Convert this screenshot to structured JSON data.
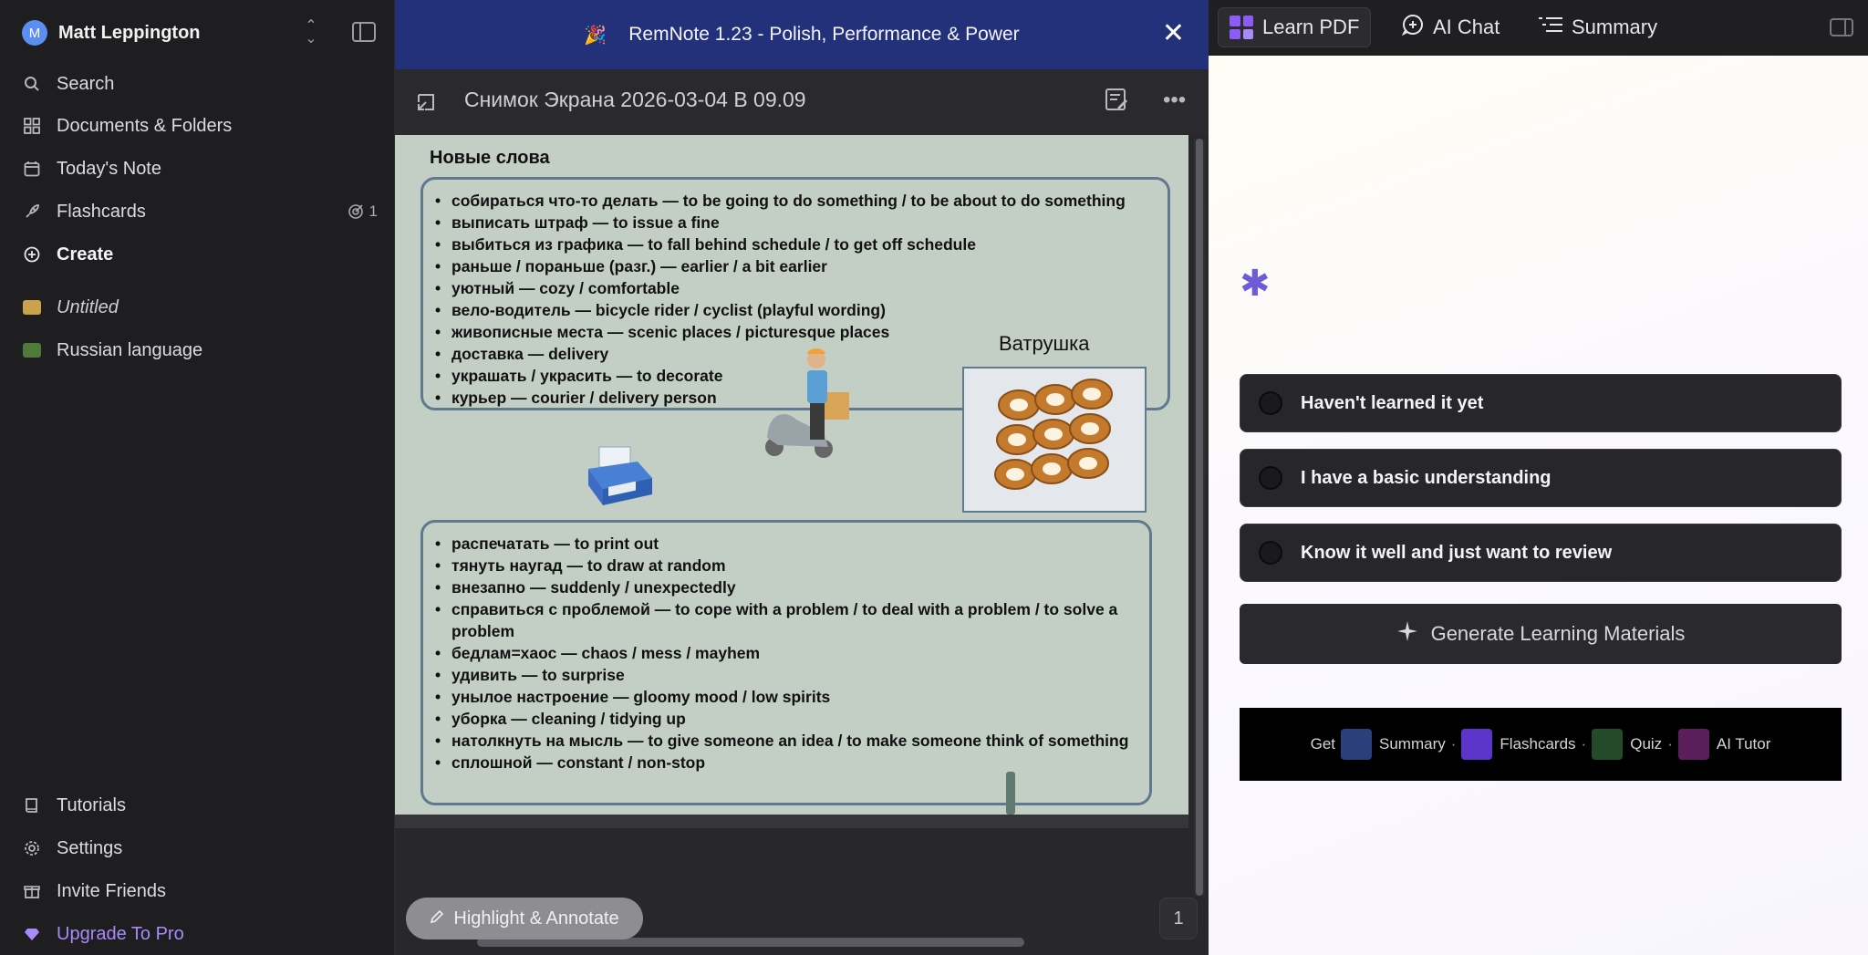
{
  "sidebar": {
    "user": {
      "initial": "M",
      "name": "Matt Leppington"
    },
    "nav": {
      "search": "Search",
      "documents": "Documents & Folders",
      "today": "Today's Note",
      "flashcards": "Flashcards",
      "flashcards_badge": "1",
      "create": "Create"
    },
    "folders": [
      {
        "label": "Untitled",
        "color": "#c9a24b"
      },
      {
        "label": "Russian language",
        "color": "#4f7a3a"
      }
    ],
    "bottom": {
      "tutorials": "Tutorials",
      "settings": "Settings",
      "invite": "Invite Friends",
      "upgrade": "Upgrade To Pro"
    }
  },
  "banner": {
    "text": "RemNote 1.23 - Polish, Performance & Power"
  },
  "document": {
    "title": "Снимок Экрана 2026-03-04 В 09.09",
    "page_heading": "Новые слова",
    "list1": [
      "собираться что-то делать — to be going to do something / to be about to do something",
      "выписать штраф — to issue a fine",
      "выбиться из графика — to fall behind schedule / to get off schedule",
      "раньше / пораньше (разг.) — earlier / a bit earlier",
      "уютный — cozy / comfortable",
      "вело-водитель — bicycle rider / cyclist (playful wording)",
      "живописные места — scenic places / picturesque places",
      "доставка — delivery",
      "украшать / украсить — to decorate",
      "курьер — courier / delivery person"
    ],
    "image_caption": "Ватрушка",
    "list2": [
      "распечатать — to print out",
      "тянуть наугад — to draw at random",
      "внезапно — suddenly / unexpectedly",
      "справиться с проблемой — to cope with a problem / to deal with a problem / to solve a problem",
      "бедлам=хаос — chaos / mess / mayhem",
      "удивить — to surprise",
      "унылое настроение — gloomy mood / low spirits",
      "уборка — cleaning / tidying up",
      "натолкнуть на мысль — to give someone an idea / to make someone think of something",
      "сплошной — constant / non-stop"
    ],
    "highlight_button": "Highlight & Annotate",
    "page_number": "1"
  },
  "right_panel": {
    "tabs": {
      "learn": "Learn PDF",
      "chat": "AI Chat",
      "summary": "Summary"
    },
    "options": [
      "Haven't learned it yet",
      "I have a basic understanding",
      "Know it well and just want to review"
    ],
    "generate_button": "Generate Learning Materials",
    "get_bar": {
      "prefix": "Get",
      "items": [
        {
          "label": "Summary",
          "color": "#2b3f7a"
        },
        {
          "label": "Flashcards",
          "color": "#5b35c9"
        },
        {
          "label": "Quiz",
          "color": "#254a2a"
        },
        {
          "label": "AI Tutor",
          "color": "#5a1f5a"
        }
      ]
    }
  },
  "colors": {
    "accent": "#a78bfa",
    "banner": "#23307a"
  }
}
